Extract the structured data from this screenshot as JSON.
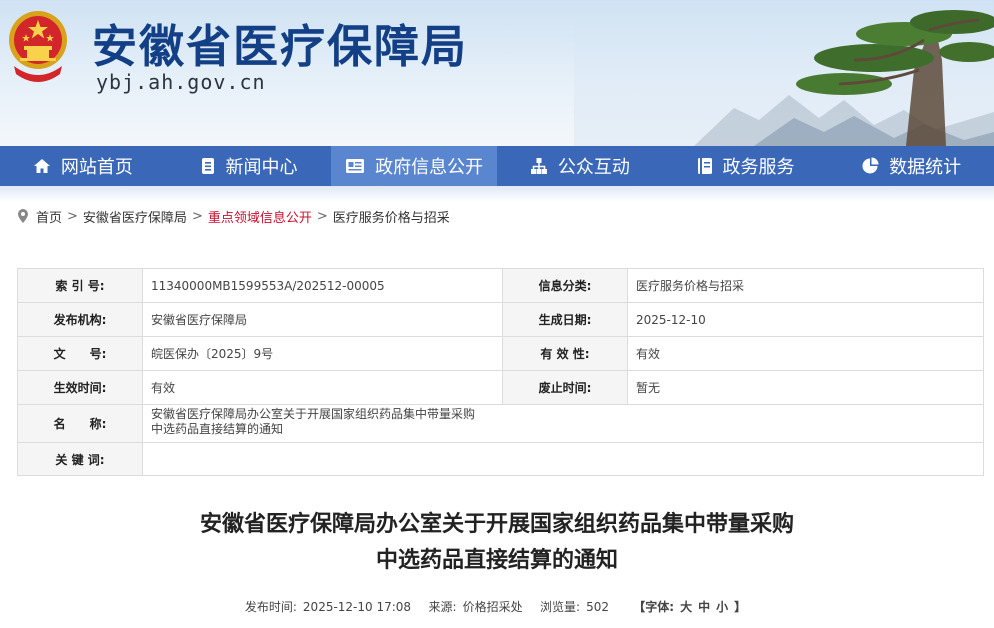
{
  "header": {
    "site_title": "安徽省医疗保障局",
    "site_domain": "ybj.ah.gov.cn"
  },
  "nav": [
    {
      "label": "网站首页",
      "icon": "home-icon"
    },
    {
      "label": "新闻中心",
      "icon": "document-icon"
    },
    {
      "label": "政府信息公开",
      "icon": "info-card-icon",
      "active": true
    },
    {
      "label": "公众互动",
      "icon": "network-icon"
    },
    {
      "label": "政务服务",
      "icon": "service-book-icon"
    },
    {
      "label": "数据统计",
      "icon": "pie-chart-icon"
    }
  ],
  "breadcrumb": {
    "home": "首页",
    "org": "安徽省医疗保障局",
    "section": "重点领域信息公开",
    "current": "医疗服务价格与招采",
    "separator": ">"
  },
  "meta": {
    "index_label": "索 引 号:",
    "index_value": "11340000MB1599553A/202512-00005",
    "category_label": "信息分类:",
    "category_value": "医疗服务价格与招采",
    "publisher_label": "发布机构:",
    "publisher_value": "安徽省医疗保障局",
    "created_label": "生成日期:",
    "created_value": "2025-12-10",
    "docno_label": "文　　号:",
    "docno_value": "皖医保办〔2025〕9号",
    "validity_label": "有 效 性:",
    "validity_value": "有效",
    "effective_label": "生效时间:",
    "effective_value": "有效",
    "repeal_label": "废止时间:",
    "repeal_value": "暂无",
    "name_label": "名　　称:",
    "name_line1": "安徽省医疗保障局办公室关于开展国家组织药品集中带量采购",
    "name_line2": "中选药品直接结算的通知",
    "keywords_label": "关 键 词:",
    "keywords_value": ""
  },
  "doc": {
    "title_line1": "安徽省医疗保障局办公室关于开展国家组织药品集中带量采购",
    "title_line2": "中选药品直接结算的通知",
    "publish_label": "发布时间:",
    "publish_value": "2025-12-10 17:08",
    "source_label": "来源:",
    "source_value": "价格招采处",
    "views_label": "浏览量:",
    "views_value": "502",
    "font_open": "【字体:",
    "font_large": "大",
    "font_medium": "中",
    "font_small": "小",
    "font_close": "】"
  },
  "colors": {
    "nav_bg": "#3a67b8",
    "nav_active": "#5a86cf",
    "title_blue": "#123f86",
    "highlight_red": "#c8102e"
  }
}
